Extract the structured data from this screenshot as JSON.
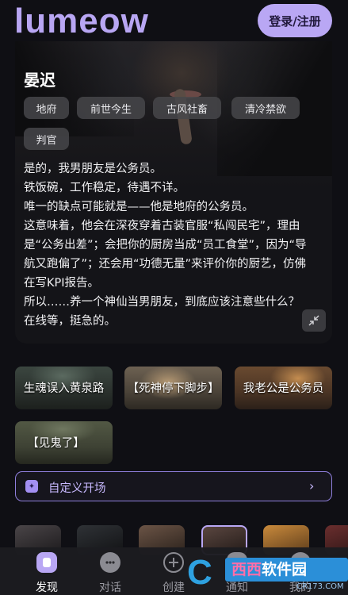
{
  "header": {
    "logo": "lumeow",
    "login_label": "登录/注册"
  },
  "character": {
    "name": "晏迟",
    "tags": [
      "地府",
      "前世今生",
      "古风社畜",
      "清冷禁欲",
      "判官"
    ],
    "intro": [
      "是的，我男朋友是公务员。",
      "铁饭碗，工作稳定，待遇不详。",
      "唯一的缺点可能就是——他是地府的公务员。",
      "这意味着，他会在深夜穿着古装官服“私闯民宅”，理由是“公务出差”；会把你的厨房当成“员工食堂”，因为“导航又跑偏了”；还会用“功德无量”来评价你的厨艺，仿佛在写KPI报告。",
      "所以……养一个神仙当男朋友，到底应该注意些什么？在线等，挺急的。"
    ],
    "collapse_icon": "collapse-arrows-icon"
  },
  "scenarios": [
    {
      "label": "生魂误入黄泉路"
    },
    {
      "label": "【死神停下脚步】"
    },
    {
      "label": "我老公是公务员"
    },
    {
      "label": "【见鬼了】"
    }
  ],
  "custom_opening": {
    "label": "自定义开场",
    "icon": "sparkle-icon",
    "chevron": "›"
  },
  "nav": {
    "items": [
      {
        "label": "发现",
        "icon": "discover-icon",
        "active": true
      },
      {
        "label": "对话",
        "icon": "chat-icon",
        "active": false
      },
      {
        "label": "创建",
        "icon": "create-icon",
        "active": false
      },
      {
        "label": "通知",
        "icon": "bell-icon",
        "active": false
      },
      {
        "label": "我的",
        "icon": "profile-icon",
        "active": false
      }
    ]
  },
  "watermark": {
    "letter": "C",
    "text_a": "西西",
    "text_b": "软件园",
    "url": "CR173.COM"
  },
  "colors": {
    "accent": "#b9a7f4",
    "background": "#0f0f14",
    "tag_bg": "#46464a"
  }
}
